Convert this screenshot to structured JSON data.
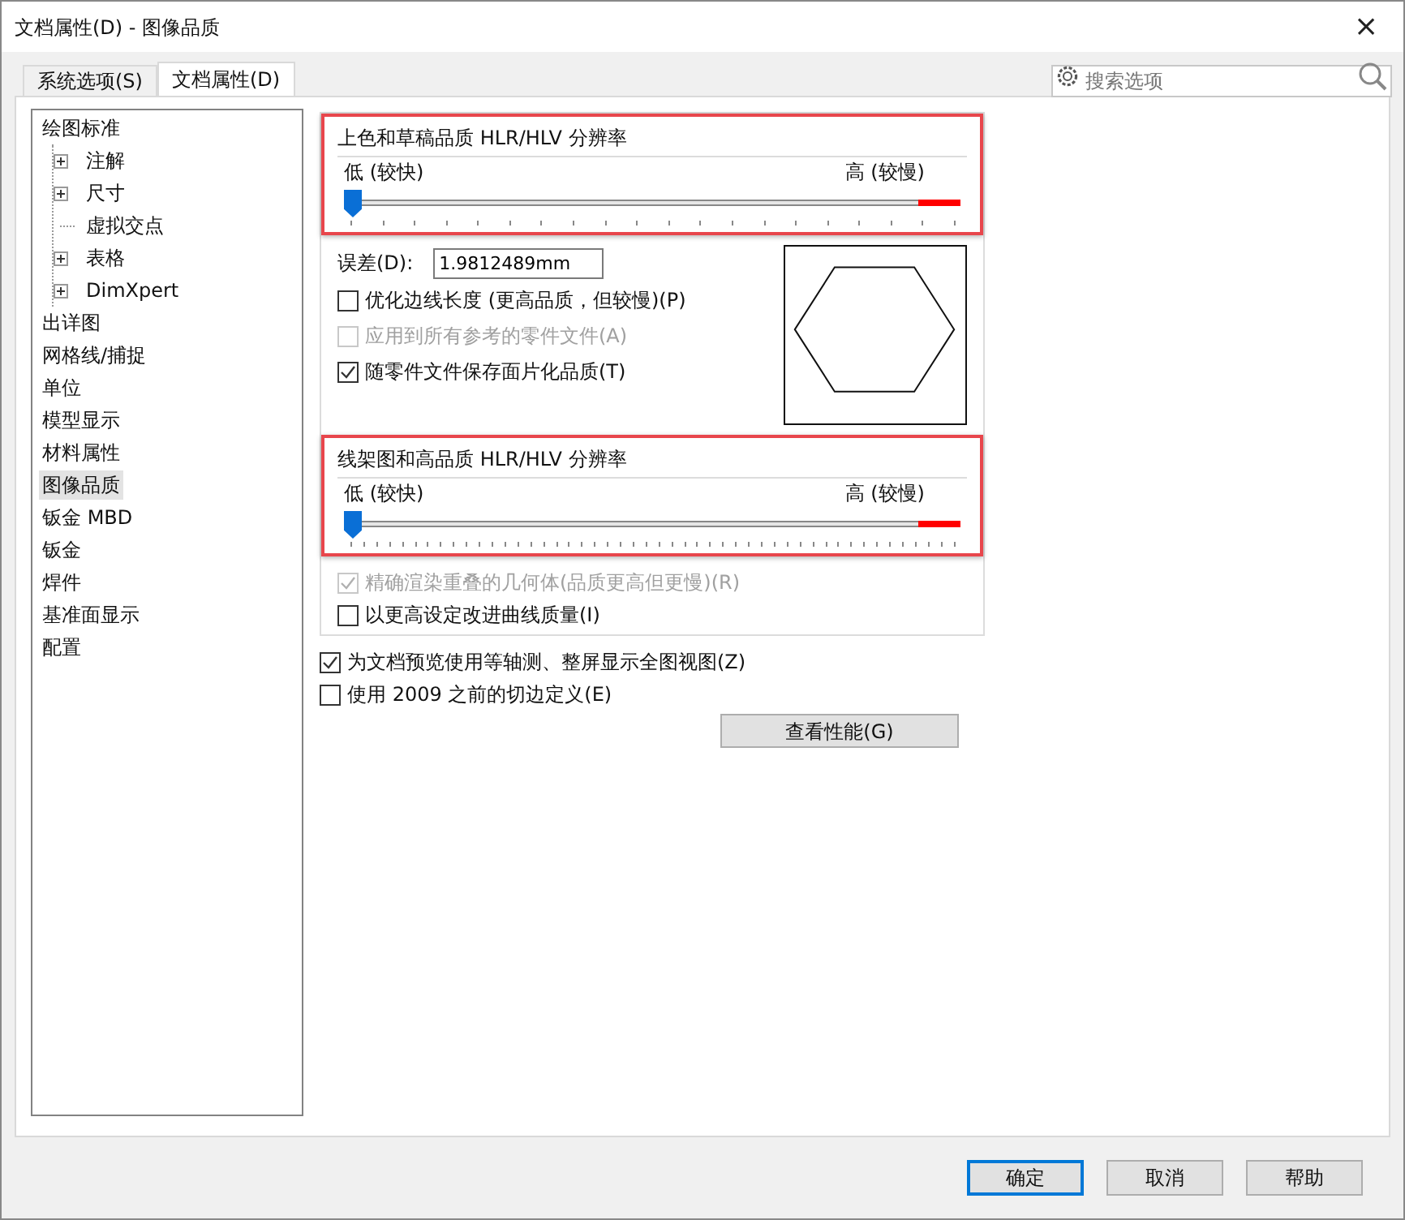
{
  "window": {
    "title": "文档属性(D) - 图像品质",
    "close": "×"
  },
  "tabs": [
    {
      "label": "系统选项(S)",
      "selected": false
    },
    {
      "label": "文档属性(D)",
      "selected": true
    }
  ],
  "search": {
    "placeholder": "搜索选项"
  },
  "tree": [
    {
      "label": "绘图标准",
      "selected": false,
      "children": [
        {
          "label": "注解",
          "expandable": true,
          "selected": false
        },
        {
          "label": "尺寸",
          "expandable": true,
          "selected": false
        },
        {
          "label": "虚拟交点",
          "expandable": false,
          "selected": false
        },
        {
          "label": "表格",
          "expandable": true,
          "selected": false
        },
        {
          "label": "DimXpert",
          "expandable": true,
          "selected": false
        }
      ]
    },
    {
      "label": "出详图",
      "selected": false
    },
    {
      "label": "网格线/捕捉",
      "selected": false
    },
    {
      "label": "单位",
      "selected": false
    },
    {
      "label": "模型显示",
      "selected": false
    },
    {
      "label": "材料属性",
      "selected": false
    },
    {
      "label": "图像品质",
      "selected": true
    },
    {
      "label": "钣金 MBD",
      "selected": false
    },
    {
      "label": "钣金",
      "selected": false
    },
    {
      "label": "焊件",
      "selected": false
    },
    {
      "label": "基准面显示",
      "selected": false
    },
    {
      "label": "配置",
      "selected": false
    }
  ],
  "shaded_group": {
    "title": "上色和草稿品质 HLR/HLV 分辨率",
    "low": "低 (较快)",
    "high": "高 (较慢)",
    "level": 0,
    "tolerance_label": "误差(D):",
    "tolerance_value": "1.9812489mm",
    "options": [
      {
        "label": "优化边线长度 (更高品质，但较慢)(P)",
        "checked": false,
        "disabled": false
      },
      {
        "label": "应用到所有参考的零件文件(A)",
        "checked": false,
        "disabled": true
      },
      {
        "label": "随零件文件保存面片化品质(T)",
        "checked": true,
        "disabled": false
      }
    ]
  },
  "wireframe_group": {
    "title": "线架图和高品质 HLR/HLV 分辨率",
    "low": "低 (较快)",
    "high": "高 (较慢)",
    "level": 0,
    "options": [
      {
        "label": "精确渲染重叠的几何体(品质更高但更慢)(R)",
        "checked": true,
        "disabled": true
      },
      {
        "label": "以更高设定改进曲线质量(I)",
        "checked": false,
        "disabled": false
      }
    ]
  },
  "options": [
    {
      "label": "为文档预览使用等轴测、整屏显示全图视图(Z)",
      "checked": true,
      "disabled": false
    },
    {
      "label": "使用 2009 之前的切边定义(E)",
      "checked": false,
      "disabled": false
    }
  ],
  "performance_button": "查看性能(G)",
  "buttons": [
    {
      "label": "确定",
      "default": true
    },
    {
      "label": "取消",
      "default": false
    },
    {
      "label": "帮助",
      "default": false
    }
  ]
}
